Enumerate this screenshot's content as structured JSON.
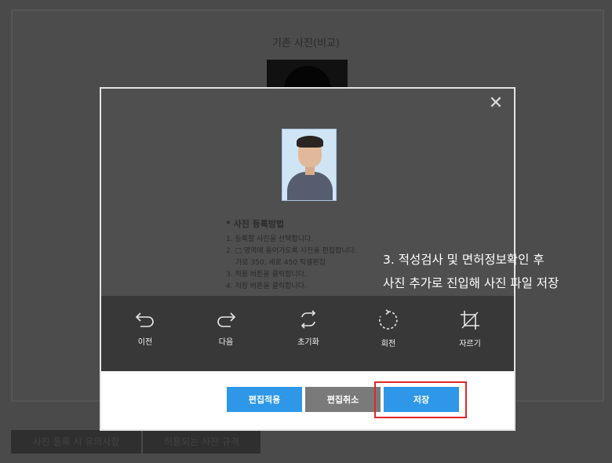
{
  "background": {
    "title": "기존 사진(비교)",
    "tabs": [
      {
        "label": "사진 등록 시 유의사항"
      },
      {
        "label": "허용되는 사진 규격"
      }
    ]
  },
  "modal": {
    "close_icon": "x-icon",
    "guide": {
      "title": "* 사진 등록방법",
      "lines": [
        "1. 등록할 사진을 선택합니다.",
        "2. □ 영역에 들어가도록 사진을 편집합니다.",
        "    가로 350, 세로 450 픽셀편집",
        "3. 적용 버튼을 클릭합니다.",
        "4. 저장 버튼을 클릭합니다."
      ]
    },
    "tools": [
      {
        "label": "이전",
        "icon": "undo-icon"
      },
      {
        "label": "다음",
        "icon": "redo-icon"
      },
      {
        "label": "초기화",
        "icon": "reset-icon"
      },
      {
        "label": "회전",
        "icon": "rotate-icon"
      },
      {
        "label": "자르기",
        "icon": "crop-icon"
      }
    ],
    "buttons": {
      "apply": "편집적용",
      "cancel": "편집취소",
      "save": "저장"
    }
  },
  "annotation": {
    "line1": "3. 적성검사 및 면허정보확인 후",
    "line2": "사진 추가로 진입해 사진 파일 저장"
  },
  "colors": {
    "primary_button": "#2e97e8",
    "secondary_button": "#7a7a7a",
    "highlight_border": "#e2262a",
    "toolbar_bg": "#383838"
  }
}
